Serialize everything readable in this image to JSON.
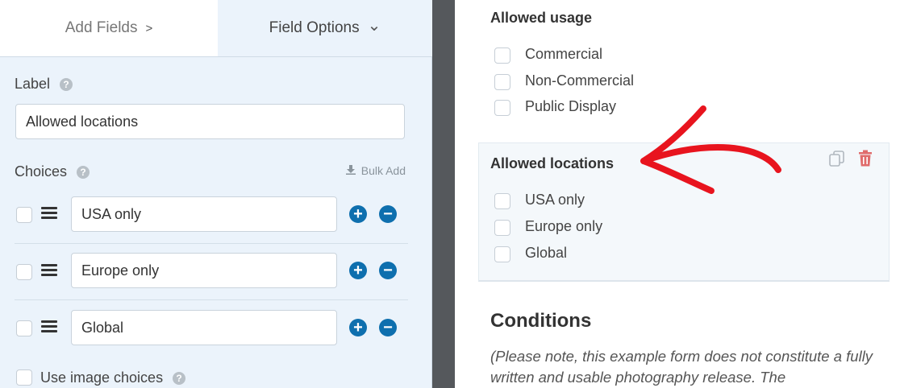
{
  "tabs": {
    "add_fields": "Add Fields",
    "add_fields_chevron": ">",
    "field_options": "Field Options",
    "field_options_chevron": "⌄"
  },
  "label": {
    "title": "Label",
    "value": "Allowed locations"
  },
  "choices": {
    "title": "Choices",
    "bulk_add": "Bulk Add",
    "items": [
      {
        "value": "USA only"
      },
      {
        "value": "Europe only"
      },
      {
        "value": "Global"
      }
    ]
  },
  "image_choices": {
    "label": "Use image choices"
  },
  "preview": {
    "allowed_usage": {
      "title": "Allowed usage",
      "options": [
        "Commercial",
        "Non-Commercial",
        "Public Display"
      ]
    },
    "allowed_locations": {
      "title": "Allowed locations",
      "options": [
        "USA only",
        "Europe only",
        "Global"
      ]
    },
    "conditions": {
      "title": "Conditions",
      "note": "(Please note, this example form does not constitute a fully written and usable photography release. The"
    }
  },
  "colors": {
    "accent_blue": "#0e6fae",
    "arrow_red": "#e8141e",
    "trash_red": "#e06b6b"
  },
  "icons": [
    "help-icon",
    "download-icon",
    "drag-handle-icon",
    "add-choice-icon",
    "remove-choice-icon",
    "duplicate-icon",
    "trash-icon"
  ]
}
